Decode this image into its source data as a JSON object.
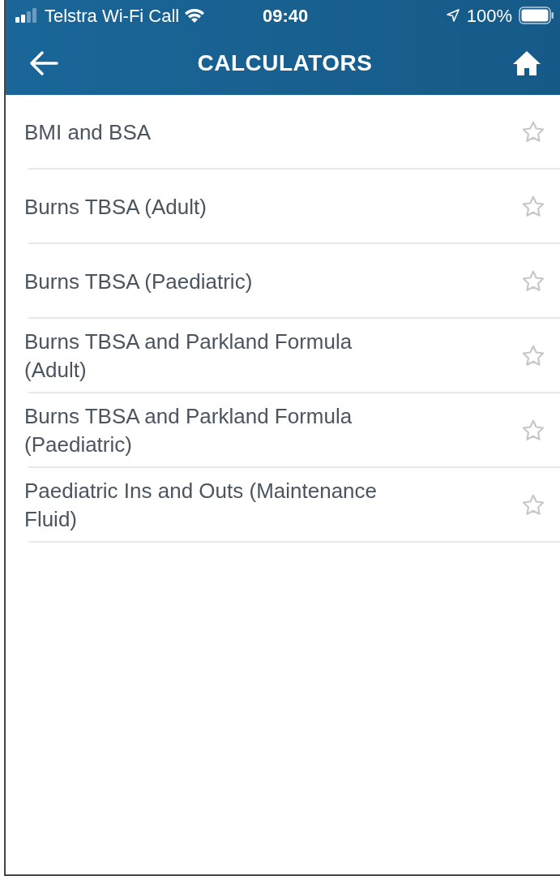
{
  "status_bar": {
    "carrier": "Telstra Wi-Fi Call",
    "time": "09:40",
    "battery": "100%"
  },
  "header": {
    "title": "CALCULATORS"
  },
  "items": [
    {
      "label": "BMI and BSA",
      "starred": false
    },
    {
      "label": "Burns TBSA (Adult)",
      "starred": false
    },
    {
      "label": "Burns TBSA (Paediatric)",
      "starred": false
    },
    {
      "label": "Burns TBSA and Parkland Formula (Adult)",
      "starred": false
    },
    {
      "label": "Burns TBSA and Parkland Formula (Paediatric)",
      "starred": false
    },
    {
      "label": "Paediatric Ins and Outs (Maintenance Fluid)",
      "starred": false
    }
  ]
}
